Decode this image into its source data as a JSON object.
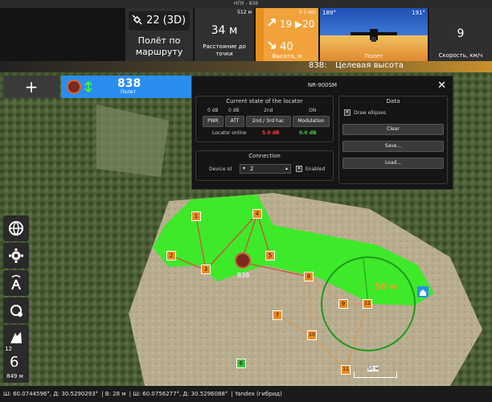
{
  "window": {
    "title": "НПУ - 838"
  },
  "telemetry": {
    "gps_value": "22 (3D)",
    "gps_mode": "Полёт по маршруту",
    "distance_small": "512 м",
    "distance_value": "34 м",
    "distance_label": "Расстояние до точки",
    "alt_vspeed": "0.1 м/с",
    "alt_up_value": "19",
    "alt_up_target": "20",
    "alt_value": "40",
    "alt_label": "Высота, м",
    "pitch_left": "189°",
    "pitch_right": "191°",
    "horizon_label": "Полет",
    "speed_value": "9",
    "speed_label": "Скорость, км/ч"
  },
  "status_strip": {
    "uav_num": "838:",
    "message": "Целевая высота"
  },
  "uav_card": {
    "number": "838",
    "label": "Полет"
  },
  "panel": {
    "title": "NR-900SM",
    "state_title": "Current state of the locator",
    "cols": [
      "0 dB",
      "0 dB",
      "2nd",
      "ON"
    ],
    "buttons": [
      "PWR",
      "ATT",
      "2nd / 3rd har.",
      "Modulation"
    ],
    "locator_label": "Locator online",
    "locator_red": "5.0 dB",
    "locator_green": "0.0 dB",
    "conn_title": "Connection",
    "device_label": "Device Id",
    "device_value": "2",
    "enabled_label": "Enabled",
    "data_title": "Data",
    "draw_ellipses": "Draw ellipses",
    "clear": "Clear",
    "save": "Save...",
    "load": "Load..."
  },
  "map": {
    "waypoints": [
      "1",
      "2",
      "3",
      "4",
      "5",
      "6",
      "7",
      "8",
      "9",
      "10",
      "11",
      "12"
    ],
    "uav_label": "838",
    "radius_label": "50 м",
    "scale_label": "50 м"
  },
  "left_counter": {
    "top": "12",
    "main": "6",
    "bottom": "849 м"
  },
  "bottombar": {
    "coord1": "Ш: 60.0744596°, Д: 30.5290293°",
    "alt": "В: 28 м",
    "coord2": "Ш: 60.0756277°, Д: 30.5296088°",
    "source": "Yandex (гибрид)"
  },
  "icons": [
    "satellite-icon",
    "arrow-up-icon",
    "arrow-down-icon",
    "globe-icon",
    "gear-icon",
    "antenna-icon",
    "waypoint-route-icon",
    "tools-icon",
    "home-icon",
    "close-icon"
  ]
}
